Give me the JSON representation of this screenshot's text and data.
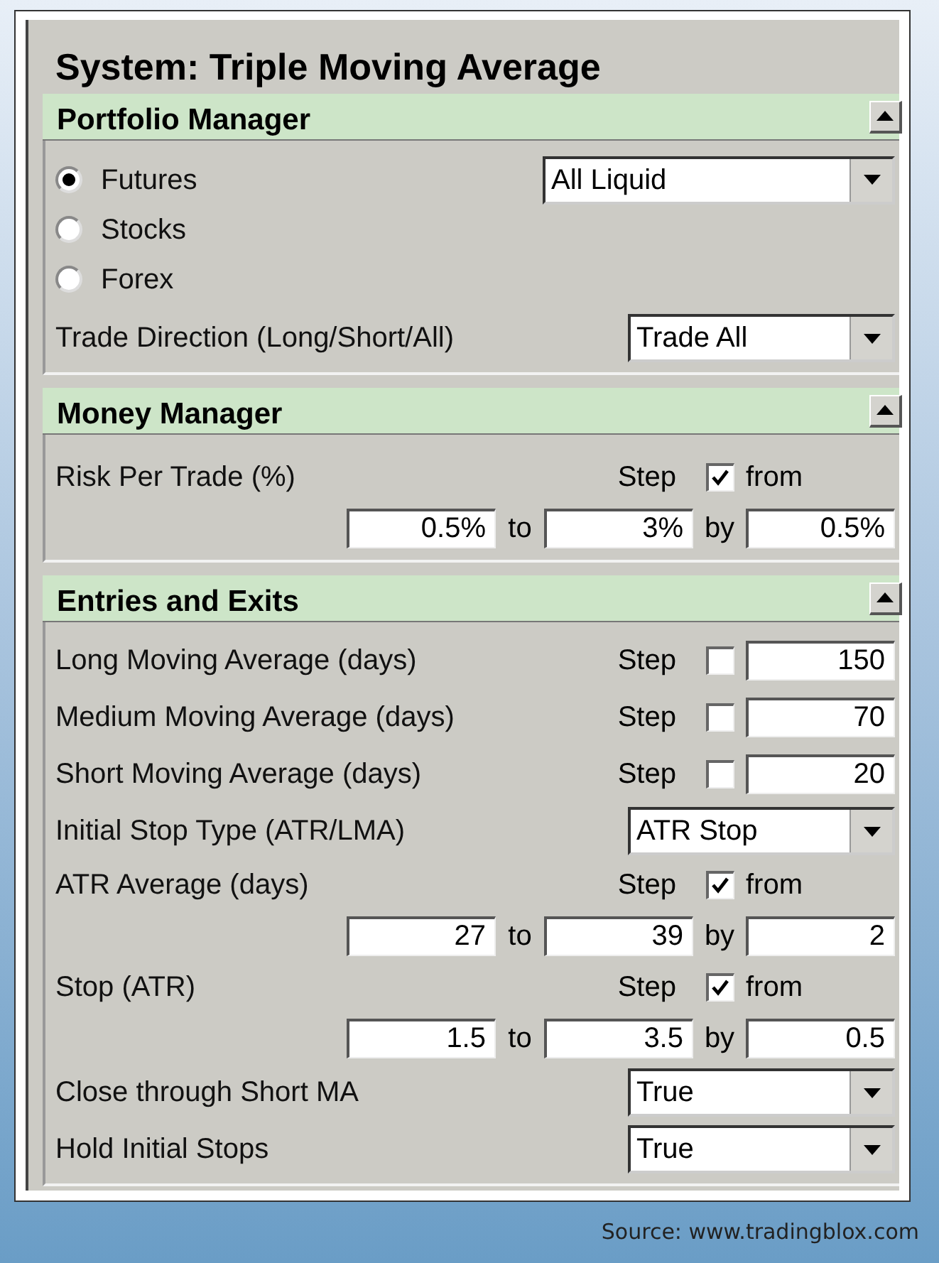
{
  "title": "System: Triple Moving Average",
  "sections": [
    {
      "title": "Portfolio Manager",
      "expanded": true,
      "rows": [
        {
          "kind": "radio",
          "label": "Futures",
          "selected": true,
          "select_value": "All Liquid"
        },
        {
          "kind": "radio",
          "label": "Stocks",
          "selected": false
        },
        {
          "kind": "radio",
          "label": "Forex",
          "selected": false
        },
        {
          "kind": "select",
          "label": "Trade Direction (Long/Short/All)",
          "value": "Trade All"
        }
      ]
    },
    {
      "title": "Money Manager",
      "expanded": true,
      "rows": [
        {
          "kind": "range",
          "label": "Risk Per Trade (%)",
          "step_label": "Step",
          "step": true,
          "from_label": "from",
          "from": "0.5%",
          "to_label": "to",
          "to": "3%",
          "by_label": "by",
          "by": "0.5%"
        }
      ]
    },
    {
      "title": "Entries and Exits",
      "expanded": true,
      "rows": [
        {
          "kind": "number",
          "label": "Long Moving Average (days)",
          "step_label": "Step",
          "step": false,
          "value": "150"
        },
        {
          "kind": "number",
          "label": "Medium Moving Average (days)",
          "step_label": "Step",
          "step": false,
          "value": "70"
        },
        {
          "kind": "number",
          "label": "Short Moving Average (days)",
          "step_label": "Step",
          "step": false,
          "value": "20"
        },
        {
          "kind": "select",
          "label": "Initial Stop Type (ATR/LMA)",
          "value": "ATR Stop"
        },
        {
          "kind": "range",
          "label": "ATR Average (days)",
          "step_label": "Step",
          "step": true,
          "from_label": "from",
          "from": "27",
          "to_label": "to",
          "to": "39",
          "by_label": "by",
          "by": "2"
        },
        {
          "kind": "range",
          "label": "Stop (ATR)",
          "step_label": "Step",
          "step": true,
          "from_label": "from",
          "from": "1.5",
          "to_label": "to",
          "to": "3.5",
          "by_label": "by",
          "by": "0.5"
        },
        {
          "kind": "select",
          "label": "Close through Short MA",
          "value": "True"
        },
        {
          "kind": "select",
          "label": "Hold Initial Stops",
          "value": "True"
        }
      ]
    }
  ],
  "source": "Source: www.tradingblox.com"
}
